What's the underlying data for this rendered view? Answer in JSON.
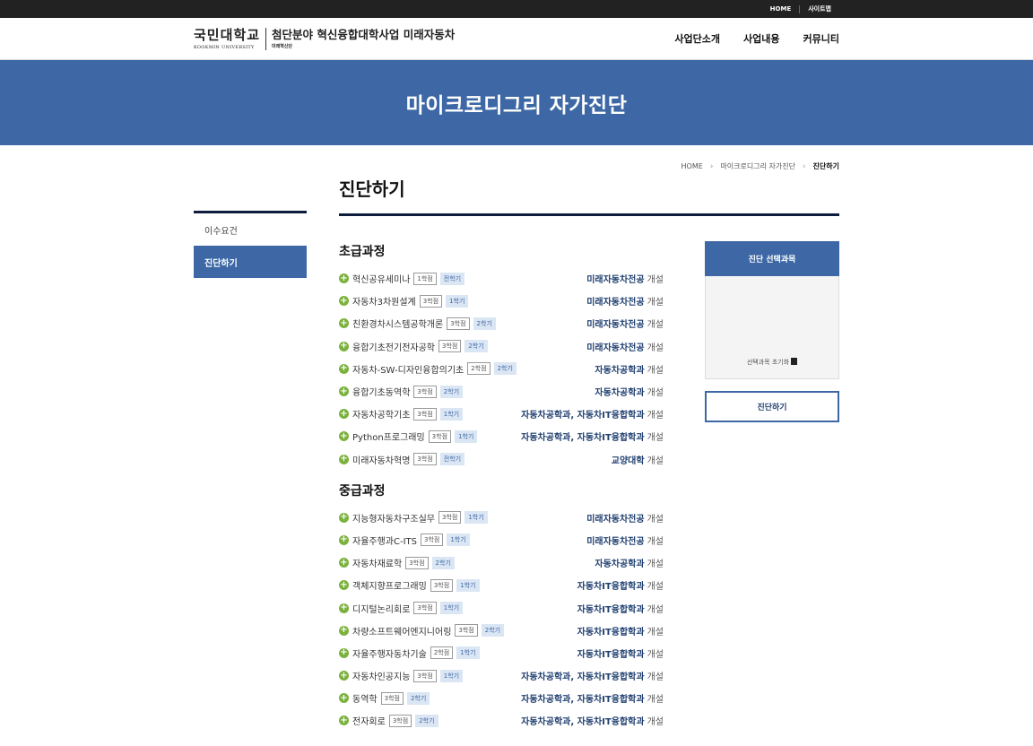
{
  "topbar": {
    "home": "HOME",
    "sitemap": "사이트맵"
  },
  "logo": {
    "univ_ko": "국민대학교",
    "univ_en": "KOOKMIN UNIVERSITY",
    "project": "첨단분야 혁신융합대학사업 미래자동차",
    "project_sub": "미래혁신단"
  },
  "nav": [
    "사업단소개",
    "사업내용",
    "커뮤니티"
  ],
  "banner": {
    "title": "마이크로디그리 자가진단"
  },
  "breadcrumb": {
    "home": "HOME",
    "section": "마이크로디그리 자가진단",
    "current": "진단하기"
  },
  "sidebar": [
    "이수요건",
    "진단하기"
  ],
  "page_title": "진단하기",
  "open_label": "개설",
  "sections": [
    {
      "title": "초급과정",
      "courses": [
        {
          "name": "혁신공유세미나",
          "credit": "1학점",
          "term": "전학기",
          "dept": "미래자동차전공"
        },
        {
          "name": "자동차3차원설계",
          "credit": "3학점",
          "term": "1학기",
          "dept": "미래자동차전공"
        },
        {
          "name": "친환경차시스템공학개론",
          "credit": "3학점",
          "term": "2학기",
          "dept": "미래자동차전공"
        },
        {
          "name": "융합기초전기전자공학",
          "credit": "3학점",
          "term": "2학기",
          "dept": "미래자동차전공"
        },
        {
          "name": "자동차-SW-디자인융합의기초",
          "credit": "2학점",
          "term": "2학기",
          "dept": "자동차공학과"
        },
        {
          "name": "융합기초동역학",
          "credit": "3학점",
          "term": "2학기",
          "dept": "자동차공학과"
        },
        {
          "name": "자동차공학기초",
          "credit": "3학점",
          "term": "1학기",
          "dept": "자동차공학과, 자동차IT융합학과"
        },
        {
          "name": "Python프로그래밍",
          "credit": "3학점",
          "term": "1학기",
          "dept": "자동차공학과, 자동차IT융합학과"
        },
        {
          "name": "미래자동차혁명",
          "credit": "3학점",
          "term": "전학기",
          "dept": "교양대학"
        }
      ]
    },
    {
      "title": "중급과정",
      "courses": [
        {
          "name": "지능형자동차구조실무",
          "credit": "3학점",
          "term": "1학기",
          "dept": "미래자동차전공"
        },
        {
          "name": "자율주행과C-ITS",
          "credit": "3학점",
          "term": "1학기",
          "dept": "미래자동차전공"
        },
        {
          "name": "자동차재료학",
          "credit": "3학점",
          "term": "2학기",
          "dept": "자동차공학과"
        },
        {
          "name": "객체지향프로그래밍",
          "credit": "3학점",
          "term": "1학기",
          "dept": "자동차IT융합학과"
        },
        {
          "name": "디지털논리회로",
          "credit": "3학점",
          "term": "1학기",
          "dept": "자동차IT융합학과"
        },
        {
          "name": "차량소프트웨어엔지니어링",
          "credit": "3학점",
          "term": "2학기",
          "dept": "자동차IT융합학과"
        },
        {
          "name": "자율주행자동차기술",
          "credit": "2학점",
          "term": "1학기",
          "dept": "자동차IT융합학과"
        },
        {
          "name": "자동차인공지능",
          "credit": "3학점",
          "term": "1학기",
          "dept": "자동차공학과, 자동차IT융합학과"
        },
        {
          "name": "동역학",
          "credit": "3학점",
          "term": "2학기",
          "dept": "자동차공학과, 자동차IT융합학과"
        },
        {
          "name": "전자회로",
          "credit": "3학점",
          "term": "2학기",
          "dept": "자동차공학과, 자동차IT융합학과"
        }
      ]
    }
  ],
  "panel": {
    "title": "진단 선택과목",
    "reset": "선택과목 초기화",
    "button": "진단하기"
  },
  "colors": {
    "primary": "#3d68a5",
    "dark": "#0e1c3e",
    "plus": "#7bb23d"
  }
}
